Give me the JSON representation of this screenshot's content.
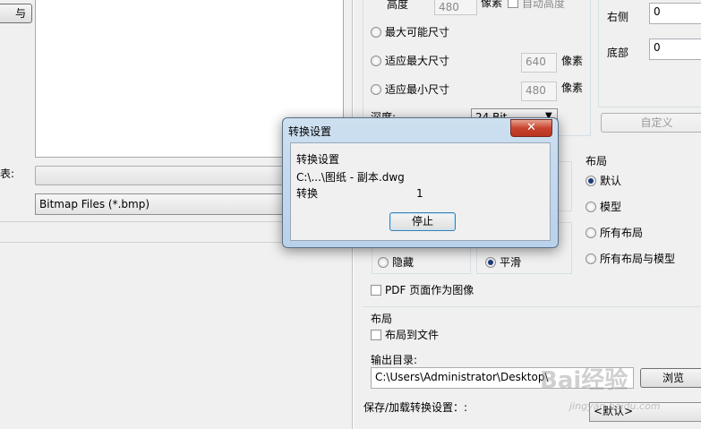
{
  "left_panel": {
    "top_button_label": "与",
    "list_label": "表:",
    "file_type_value": "Bitmap Files (*.bmp)"
  },
  "size_options": {
    "height_label": "高度",
    "height_value": "480",
    "height_unit": "像素",
    "auto_height_label": "自动高度",
    "option_max_possible": "最大可能尺寸",
    "option_fit_max": "适应最大尺寸",
    "fit_max_value": "640",
    "fit_max_unit": "像素",
    "option_fit_min": "适应最小尺寸",
    "fit_min_value": "480",
    "fit_min_unit": "像素",
    "depth_label": "深度:",
    "depth_value": "24 Bit"
  },
  "margins": {
    "right_label": "右侧",
    "right_value": "0",
    "bottom_label": "底部",
    "bottom_value": "0",
    "custom_button": "自定义"
  },
  "layout_group": {
    "title": "布局",
    "option_default": "默认",
    "option_model": "模型",
    "option_all_layouts": "所有布局",
    "option_all_layouts_model": "所有布局与模型"
  },
  "hidden_group": {
    "option_hide": "隐藏",
    "option_smooth": "平滑"
  },
  "pdf_option": "PDF 页面作为图像",
  "layout_section": {
    "title": "布局",
    "layout_to_file": "布局到文件"
  },
  "output": {
    "label": "输出目录:",
    "path": "C:\\Users\\Administrator\\Desktop\\",
    "browse_button": "浏览"
  },
  "save_load": {
    "label": "保存/加载转换设置：:",
    "value": "<默认>"
  },
  "dialog": {
    "title": "转换设置",
    "close_glyph": "✕",
    "heading": "转换设置",
    "file_path": "C:\\...\\图纸 - 副本.dwg",
    "convert_label": "转换",
    "convert_count": "1",
    "stop_button": "停止"
  },
  "watermark": {
    "brand": "Bai经验",
    "url": "jingyan.baidu.com"
  }
}
